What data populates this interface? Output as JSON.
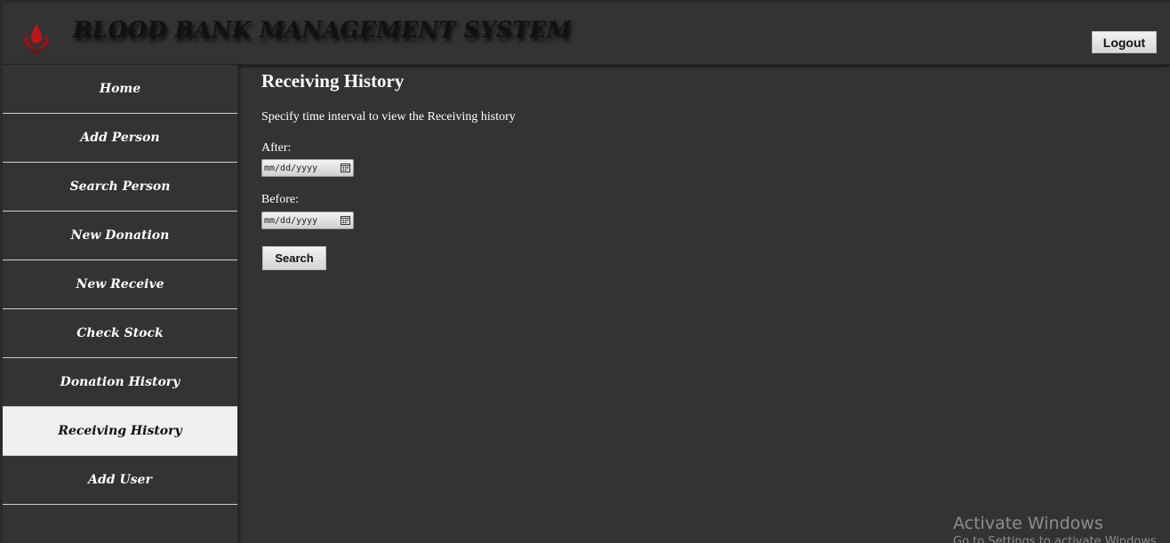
{
  "header": {
    "app_title": "BLOOD BANK MANAGEMENT SYSTEM",
    "logo_icon": "blood-drop-hands-logo",
    "logout_label": "Logout"
  },
  "sidebar": {
    "items": [
      {
        "label": "Home",
        "active": false
      },
      {
        "label": "Add Person",
        "active": false
      },
      {
        "label": "Search Person",
        "active": false
      },
      {
        "label": "New Donation",
        "active": false
      },
      {
        "label": "New Receive",
        "active": false
      },
      {
        "label": "Check Stock",
        "active": false
      },
      {
        "label": "Donation History",
        "active": false
      },
      {
        "label": "Receiving History",
        "active": true
      },
      {
        "label": "Add User",
        "active": false
      }
    ]
  },
  "main": {
    "title": "Receiving History",
    "intro": "Specify time interval to view the Receiving history",
    "after_label": "After:",
    "after_placeholder": "mm/dd/yyyy",
    "before_label": "Before:",
    "before_placeholder": "mm/dd/yyyy",
    "search_label": "Search"
  },
  "watermark": {
    "title": "Activate Windows",
    "subtitle": "Go to Settings to activate Windows."
  },
  "colors": {
    "background": "#333333",
    "active_nav_bg": "#efefef",
    "logo_red": "#c0141b"
  }
}
